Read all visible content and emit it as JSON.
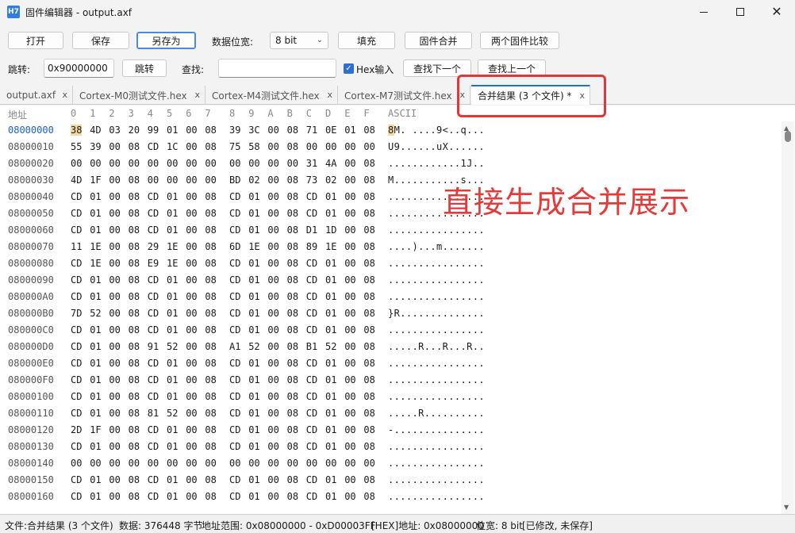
{
  "window": {
    "icon_text": "H7",
    "title": "固件编辑器 - output.axf"
  },
  "toolbar": {
    "open": "打开",
    "save": "保存",
    "save_as": "另存为",
    "bit_width_label": "数据位宽:",
    "bit_width_value": "8 bit",
    "fill": "填充",
    "merge": "固件合并",
    "compare": "两个固件比较",
    "jump_label": "跳转:",
    "jump_value": "0x90000000",
    "jump_button": "跳转",
    "find_label": "查找:",
    "find_value": "",
    "hex_input_label": "Hex输入",
    "find_next": "查找下一个",
    "find_prev": "查找上一个"
  },
  "tabs": [
    {
      "label": "output.axf",
      "close": "x"
    },
    {
      "label": "Cortex-M0测试文件.hex",
      "close": "x"
    },
    {
      "label": "Cortex-M4测试文件.hex",
      "close": "x"
    },
    {
      "label": "Cortex-M7测试文件.hex",
      "close": "x"
    },
    {
      "label": "合并结果 (3 个文件) *",
      "close": "x"
    }
  ],
  "annotation": "直接生成合并展示",
  "hex": {
    "header_addr": "地址",
    "header_cols": [
      "0",
      "1",
      "2",
      "3",
      "4",
      "5",
      "6",
      "7",
      "8",
      "9",
      "A",
      "B",
      "C",
      "D",
      "E",
      "F"
    ],
    "header_ascii": "ASCII",
    "rows": [
      {
        "addr": "08000000",
        "bytes": [
          "38",
          "4D",
          "03",
          "20",
          "99",
          "01",
          "00",
          "08",
          "39",
          "3C",
          "00",
          "08",
          "71",
          "0E",
          "01",
          "08"
        ],
        "ascii": "8M. ....9<..q..."
      },
      {
        "addr": "08000010",
        "bytes": [
          "55",
          "39",
          "00",
          "08",
          "CD",
          "1C",
          "00",
          "08",
          "75",
          "58",
          "00",
          "08",
          "00",
          "00",
          "00",
          "00"
        ],
        "ascii": "U9......uX......"
      },
      {
        "addr": "08000020",
        "bytes": [
          "00",
          "00",
          "00",
          "00",
          "00",
          "00",
          "00",
          "00",
          "00",
          "00",
          "00",
          "00",
          "31",
          "4A",
          "00",
          "08"
        ],
        "ascii": "............1J.."
      },
      {
        "addr": "08000030",
        "bytes": [
          "4D",
          "1F",
          "00",
          "08",
          "00",
          "00",
          "00",
          "00",
          "BD",
          "02",
          "00",
          "08",
          "73",
          "02",
          "00",
          "08"
        ],
        "ascii": "M...........s..."
      },
      {
        "addr": "08000040",
        "bytes": [
          "CD",
          "01",
          "00",
          "08",
          "CD",
          "01",
          "00",
          "08",
          "CD",
          "01",
          "00",
          "08",
          "CD",
          "01",
          "00",
          "08"
        ],
        "ascii": "................"
      },
      {
        "addr": "08000050",
        "bytes": [
          "CD",
          "01",
          "00",
          "08",
          "CD",
          "01",
          "00",
          "08",
          "CD",
          "01",
          "00",
          "08",
          "CD",
          "01",
          "00",
          "08"
        ],
        "ascii": "................"
      },
      {
        "addr": "08000060",
        "bytes": [
          "CD",
          "01",
          "00",
          "08",
          "CD",
          "01",
          "00",
          "08",
          "CD",
          "01",
          "00",
          "08",
          "D1",
          "1D",
          "00",
          "08"
        ],
        "ascii": "................"
      },
      {
        "addr": "08000070",
        "bytes": [
          "11",
          "1E",
          "00",
          "08",
          "29",
          "1E",
          "00",
          "08",
          "6D",
          "1E",
          "00",
          "08",
          "89",
          "1E",
          "00",
          "08"
        ],
        "ascii": "....)...m......."
      },
      {
        "addr": "08000080",
        "bytes": [
          "CD",
          "1E",
          "00",
          "08",
          "E9",
          "1E",
          "00",
          "08",
          "CD",
          "01",
          "00",
          "08",
          "CD",
          "01",
          "00",
          "08"
        ],
        "ascii": "................"
      },
      {
        "addr": "08000090",
        "bytes": [
          "CD",
          "01",
          "00",
          "08",
          "CD",
          "01",
          "00",
          "08",
          "CD",
          "01",
          "00",
          "08",
          "CD",
          "01",
          "00",
          "08"
        ],
        "ascii": "................"
      },
      {
        "addr": "080000A0",
        "bytes": [
          "CD",
          "01",
          "00",
          "08",
          "CD",
          "01",
          "00",
          "08",
          "CD",
          "01",
          "00",
          "08",
          "CD",
          "01",
          "00",
          "08"
        ],
        "ascii": "................"
      },
      {
        "addr": "080000B0",
        "bytes": [
          "7D",
          "52",
          "00",
          "08",
          "CD",
          "01",
          "00",
          "08",
          "CD",
          "01",
          "00",
          "08",
          "CD",
          "01",
          "00",
          "08"
        ],
        "ascii": "}R.............."
      },
      {
        "addr": "080000C0",
        "bytes": [
          "CD",
          "01",
          "00",
          "08",
          "CD",
          "01",
          "00",
          "08",
          "CD",
          "01",
          "00",
          "08",
          "CD",
          "01",
          "00",
          "08"
        ],
        "ascii": "................"
      },
      {
        "addr": "080000D0",
        "bytes": [
          "CD",
          "01",
          "00",
          "08",
          "91",
          "52",
          "00",
          "08",
          "A1",
          "52",
          "00",
          "08",
          "B1",
          "52",
          "00",
          "08"
        ],
        "ascii": ".....R...R...R.."
      },
      {
        "addr": "080000E0",
        "bytes": [
          "CD",
          "01",
          "00",
          "08",
          "CD",
          "01",
          "00",
          "08",
          "CD",
          "01",
          "00",
          "08",
          "CD",
          "01",
          "00",
          "08"
        ],
        "ascii": "................"
      },
      {
        "addr": "080000F0",
        "bytes": [
          "CD",
          "01",
          "00",
          "08",
          "CD",
          "01",
          "00",
          "08",
          "CD",
          "01",
          "00",
          "08",
          "CD",
          "01",
          "00",
          "08"
        ],
        "ascii": "................"
      },
      {
        "addr": "08000100",
        "bytes": [
          "CD",
          "01",
          "00",
          "08",
          "CD",
          "01",
          "00",
          "08",
          "CD",
          "01",
          "00",
          "08",
          "CD",
          "01",
          "00",
          "08"
        ],
        "ascii": "................"
      },
      {
        "addr": "08000110",
        "bytes": [
          "CD",
          "01",
          "00",
          "08",
          "81",
          "52",
          "00",
          "08",
          "CD",
          "01",
          "00",
          "08",
          "CD",
          "01",
          "00",
          "08"
        ],
        "ascii": ".....R.........."
      },
      {
        "addr": "08000120",
        "bytes": [
          "2D",
          "1F",
          "00",
          "08",
          "CD",
          "01",
          "00",
          "08",
          "CD",
          "01",
          "00",
          "08",
          "CD",
          "01",
          "00",
          "08"
        ],
        "ascii": "-..............."
      },
      {
        "addr": "08000130",
        "bytes": [
          "CD",
          "01",
          "00",
          "08",
          "CD",
          "01",
          "00",
          "08",
          "CD",
          "01",
          "00",
          "08",
          "CD",
          "01",
          "00",
          "08"
        ],
        "ascii": "................"
      },
      {
        "addr": "08000140",
        "bytes": [
          "00",
          "00",
          "00",
          "00",
          "00",
          "00",
          "00",
          "00",
          "00",
          "00",
          "00",
          "00",
          "00",
          "00",
          "00",
          "00"
        ],
        "ascii": "................"
      },
      {
        "addr": "08000150",
        "bytes": [
          "CD",
          "01",
          "00",
          "08",
          "CD",
          "01",
          "00",
          "08",
          "CD",
          "01",
          "00",
          "08",
          "CD",
          "01",
          "00",
          "08"
        ],
        "ascii": "................"
      },
      {
        "addr": "08000160",
        "bytes": [
          "CD",
          "01",
          "00",
          "08",
          "CD",
          "01",
          "00",
          "08",
          "CD",
          "01",
          "00",
          "08",
          "CD",
          "01",
          "00",
          "08"
        ],
        "ascii": "................"
      }
    ]
  },
  "status": {
    "file": "文件:合并结果 (3 个文件)",
    "size": "数据: 376448 字节",
    "range": "地址范围: 0x08000000 - 0xD00003FF",
    "cursor": "[HEX]地址: 0x08000000",
    "width": "位宽: 8 bit",
    "state": "[已修改, 未保存]"
  },
  "colors": {
    "accent": "#1e6fd9",
    "annotation": "#e53a3a",
    "selection": "#f5d9a3"
  }
}
